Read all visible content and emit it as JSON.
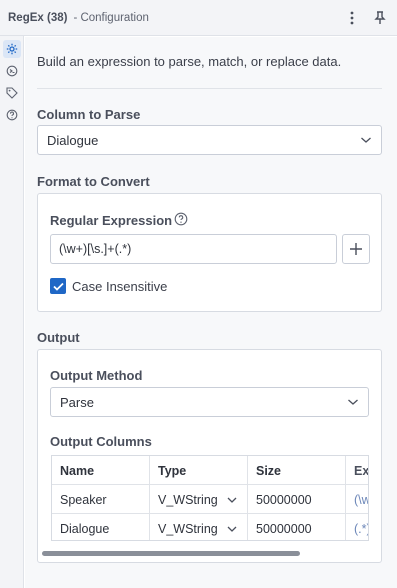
{
  "header": {
    "title": "RegEx (38)",
    "subtitle": "- Configuration",
    "menu_icon": "more-vertical-icon",
    "pin_icon": "pin-icon"
  },
  "siderail": {
    "items": [
      {
        "icon": "gear-icon",
        "active": true
      },
      {
        "icon": "connection-icon",
        "active": false
      },
      {
        "icon": "tag-icon",
        "active": false
      },
      {
        "icon": "help-circle-icon",
        "active": false
      }
    ]
  },
  "description": "Build an expression to parse, match, or replace data.",
  "column_to_parse": {
    "label": "Column to Parse",
    "value": "Dialogue"
  },
  "format_to_convert": {
    "label": "Format to Convert",
    "regex_label": "Regular Expression",
    "regex_value": "(\\w+)[\\s.]+(.*)",
    "case_insensitive_label": "Case Insensitive",
    "case_insensitive_checked": true
  },
  "output": {
    "label": "Output",
    "method_label": "Output Method",
    "method_value": "Parse",
    "columns_label": "Output Columns",
    "columns": {
      "headers": [
        "Name",
        "Type",
        "Size",
        "Exp"
      ],
      "rows": [
        {
          "name": "Speaker",
          "type": "V_WString",
          "size": "50000000",
          "exp": "(\\w"
        },
        {
          "name": "Dialogue",
          "type": "V_WString",
          "size": "50000000",
          "exp": "(.*)"
        }
      ]
    }
  },
  "colors": {
    "accent": "#1f67c6",
    "panel_bg": "#f7f8fa",
    "border": "#d7dbe2"
  }
}
